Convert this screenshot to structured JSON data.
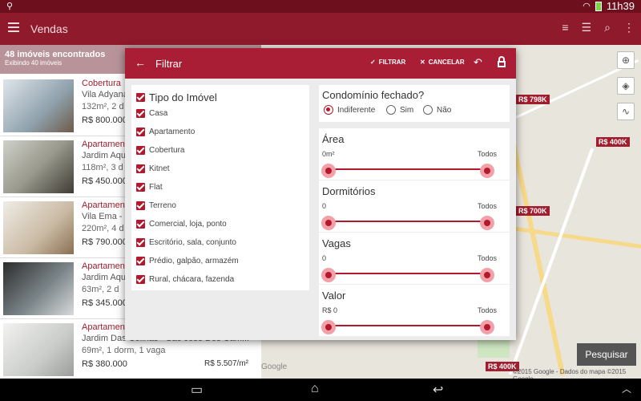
{
  "statusbar": {
    "time": "11h39"
  },
  "appbar": {
    "title": "Vendas"
  },
  "list": {
    "count": "48 imóveis encontrados",
    "showing": "Exibindo 40 imóveis",
    "items": [
      {
        "type": "Cobertura",
        "addr": "Vila Adyana",
        "info": "132m², 2 d",
        "price": "R$ 800.000",
        "ppm": ""
      },
      {
        "type": "Apartamento",
        "addr": "Jardim Aqu",
        "info": "118m², 3 d",
        "price": "R$ 450.000",
        "ppm": ""
      },
      {
        "type": "Apartamento",
        "addr": "Vila Ema - S",
        "info": "220m², 4 d",
        "price": "R$ 790.000",
        "ppm": ""
      },
      {
        "type": "Apartamento",
        "addr": "Jardim Aqu",
        "info": "63m², 2 d",
        "price": "R$ 345.000",
        "ppm": ""
      },
      {
        "type": "Apartamento",
        "addr": "Jardim Das Colinas - São José Dos Cam...",
        "info": "69m², 1 dorm, 1 vaga",
        "price": "R$ 380.000",
        "ppm": "R$ 5.507/m²"
      }
    ]
  },
  "map": {
    "pins": [
      "R$ 798K",
      "R$ 400K",
      "R$ 700K",
      "R$ 400K"
    ],
    "google": "Google",
    "copyright": "©2015 Google - Dados do mapa ©2015 Google",
    "search_button": "Pesquisar"
  },
  "dialog": {
    "title": "Filtrar",
    "filtrar_label": "FILTRAR",
    "cancelar_label": "CANCELAR",
    "tipo_title": "Tipo do Imóvel",
    "tipos": [
      "Casa",
      "Apartamento",
      "Cobertura",
      "Kitnet",
      "Flat",
      "Terreno",
      "Comercial, loja, ponto",
      "Escritório, sala, conjunto",
      "Prédio, galpão, armazém",
      "Rural, chácara, fazenda"
    ],
    "condominio": {
      "title": "Condomínio fechado?",
      "options": [
        "Indiferente",
        "Sim",
        "Não"
      ],
      "selected": "Indiferente"
    },
    "ranges": [
      {
        "title": "Área",
        "min": "0m²",
        "max": "Todos"
      },
      {
        "title": "Dormitórios",
        "min": "0",
        "max": "Todos"
      },
      {
        "title": "Vagas",
        "min": "0",
        "max": "Todos"
      },
      {
        "title": "Valor",
        "min": "R$ 0",
        "max": "Todos"
      }
    ]
  },
  "colors": {
    "primary": "#a91e34",
    "appbar": "#8e1a2c"
  },
  "icons": {
    "status": [
      "usb-icon",
      "wifi-icon",
      "battery-icon"
    ],
    "appbar": [
      "filter-icon",
      "sort-icon",
      "search-icon",
      "more-icon"
    ]
  }
}
